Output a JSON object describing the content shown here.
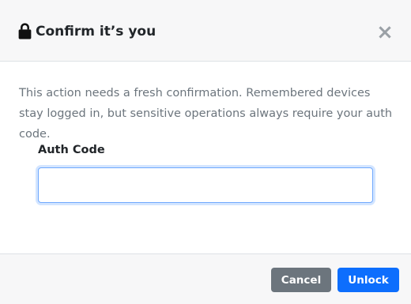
{
  "modal": {
    "title": "Confirm it’s you",
    "title_icon": "lock-icon",
    "close_label": "×",
    "description": "This action needs a fresh confirmation. Remembered devices stay logged in, but sensitive operations always require your auth code.",
    "auth_code": {
      "label": "Auth Code",
      "value": "",
      "placeholder": ""
    },
    "buttons": {
      "cancel": "Cancel",
      "unlock": "Unlock"
    },
    "colors": {
      "primary": "#0d6efd",
      "secondary": "#6c757d",
      "header_bg": "#f7f7f8",
      "text": "#212529",
      "muted_text": "#6c757d"
    }
  }
}
